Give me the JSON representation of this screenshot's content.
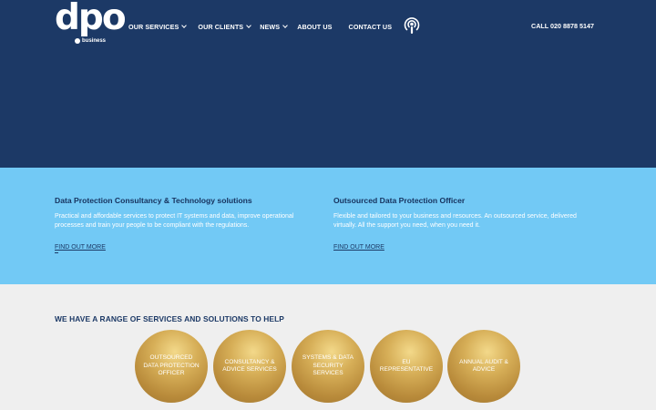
{
  "brand": {
    "logo_text": "dpo",
    "logo_sub": "business"
  },
  "nav": {
    "items": [
      {
        "label": "OUR SERVICES",
        "dropdown": true
      },
      {
        "label": "OUR CLIENTS",
        "dropdown": true
      },
      {
        "label": "NEWS",
        "dropdown": true
      },
      {
        "label": "ABOUT US",
        "dropdown": false
      },
      {
        "label": "CONTACT US",
        "dropdown": false
      }
    ],
    "podcast_icon": "podcast-icon",
    "phone": "CALL 020 8878 5147"
  },
  "band": {
    "left": {
      "title": "Data Protection Consultancy & Technology solutions",
      "text": "Practical and affordable services to protect IT systems and data, improve operational processes and train your people to be compliant with the regulations.",
      "link": "FIND OUT MORE"
    },
    "right": {
      "title": "Outsourced Data Protection Officer",
      "text": "Flexible and tailored to your business and resources.  An outsourced service, delivered virtually.  All the support you need, when you need it.",
      "link": "FIND OUT MORE"
    }
  },
  "services": {
    "heading": "WE HAVE A RANGE OF SERVICES AND SOLUTIONS TO HELP",
    "circles": [
      "OUTSOURCED DATA PROTECTION OFFICER",
      "CONSULTANCY & ADVICE SERVICES",
      "SYSTEMS & DATA SECURITY SERVICES",
      "EU REPRESENTATIVE",
      "ANNUAL AUDIT & ADVICE"
    ]
  },
  "colors": {
    "navy": "#1c3966",
    "sky": "#72c9f5",
    "light_grey": "#efefef",
    "gold": "#c9a24c"
  }
}
